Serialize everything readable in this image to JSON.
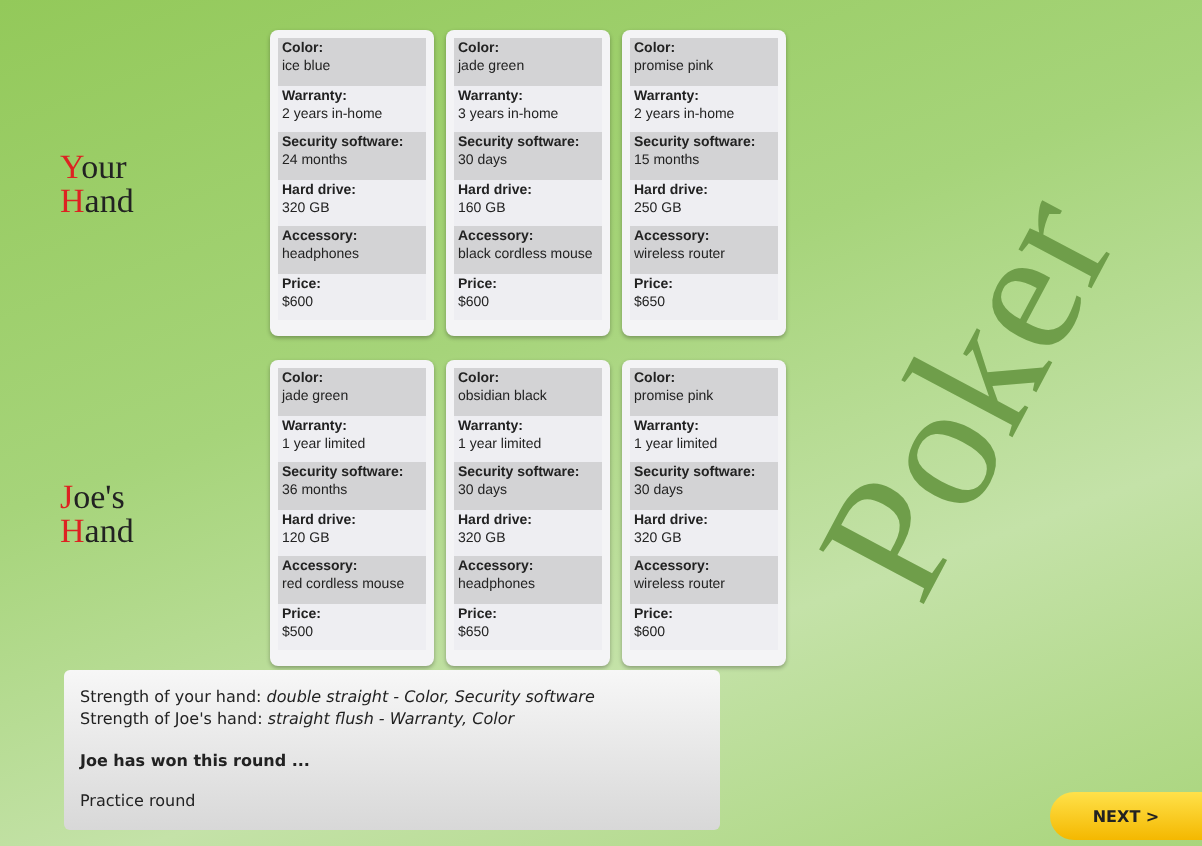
{
  "background_title": "Poker",
  "hands": [
    {
      "label": [
        "Your",
        "Hand"
      ],
      "cards": [
        {
          "fields": [
            {
              "label": "Color:",
              "value": "ice blue"
            },
            {
              "label": "Warranty:",
              "value": "2 years in-home"
            },
            {
              "label": "Security software:",
              "value": "24 months"
            },
            {
              "label": "Hard drive:",
              "value": "320 GB"
            },
            {
              "label": "Accessory:",
              "value": "headphones"
            },
            {
              "label": "Price:",
              "value": "$600"
            }
          ]
        },
        {
          "fields": [
            {
              "label": "Color:",
              "value": "jade green"
            },
            {
              "label": "Warranty:",
              "value": "3 years in-home"
            },
            {
              "label": "Security software:",
              "value": "30 days"
            },
            {
              "label": "Hard drive:",
              "value": "160 GB"
            },
            {
              "label": "Accessory:",
              "value": "black cordless mouse"
            },
            {
              "label": "Price:",
              "value": "$600"
            }
          ]
        },
        {
          "fields": [
            {
              "label": "Color:",
              "value": "promise pink"
            },
            {
              "label": "Warranty:",
              "value": "2 years in-home"
            },
            {
              "label": "Security software:",
              "value": "15 months"
            },
            {
              "label": "Hard drive:",
              "value": "250 GB"
            },
            {
              "label": "Accessory:",
              "value": "wireless router"
            },
            {
              "label": "Price:",
              "value": "$650"
            }
          ]
        }
      ]
    },
    {
      "label": [
        "Joe's",
        "Hand"
      ],
      "cards": [
        {
          "fields": [
            {
              "label": "Color:",
              "value": "jade green"
            },
            {
              "label": "Warranty:",
              "value": "1 year limited"
            },
            {
              "label": "Security software:",
              "value": "36 months"
            },
            {
              "label": "Hard drive:",
              "value": "120 GB"
            },
            {
              "label": "Accessory:",
              "value": "red cordless mouse"
            },
            {
              "label": "Price:",
              "value": "$500"
            }
          ]
        },
        {
          "fields": [
            {
              "label": "Color:",
              "value": "obsidian black"
            },
            {
              "label": "Warranty:",
              "value": "1 year limited"
            },
            {
              "label": "Security software:",
              "value": "30 days"
            },
            {
              "label": "Hard drive:",
              "value": "320 GB"
            },
            {
              "label": "Accessory:",
              "value": "headphones"
            },
            {
              "label": "Price:",
              "value": "$650"
            }
          ]
        },
        {
          "fields": [
            {
              "label": "Color:",
              "value": "promise pink"
            },
            {
              "label": "Warranty:",
              "value": "1 year limited"
            },
            {
              "label": "Security software:",
              "value": "30 days"
            },
            {
              "label": "Hard drive:",
              "value": "320 GB"
            },
            {
              "label": "Accessory:",
              "value": "wireless router"
            },
            {
              "label": "Price:",
              "value": "$600"
            }
          ]
        }
      ]
    }
  ],
  "result": {
    "lines": [
      "Strength of your hand: *double straight - Color, Security software*",
      "Strength of Joe's hand: *straight flush - Warranty, Color*"
    ],
    "verdict": "Joe has won this round ...",
    "note": "Practice round"
  },
  "next_button": "NEXT >"
}
